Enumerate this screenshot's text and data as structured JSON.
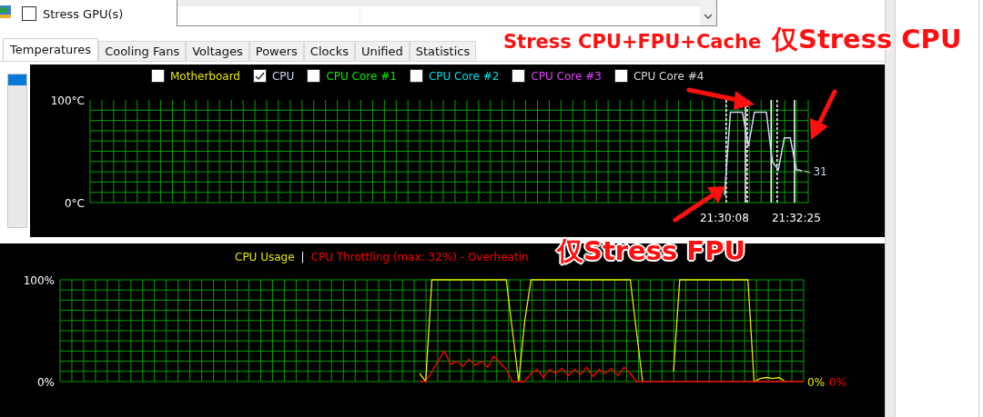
{
  "toolbar": {
    "stress_gpu": {
      "label": "Stress GPU(s)",
      "checked": false
    }
  },
  "tabs": [
    {
      "label": "Temperatures",
      "selected": true
    },
    {
      "label": "Cooling Fans",
      "selected": false
    },
    {
      "label": "Voltages",
      "selected": false
    },
    {
      "label": "Powers",
      "selected": false
    },
    {
      "label": "Clocks",
      "selected": false
    },
    {
      "label": "Unified",
      "selected": false
    },
    {
      "label": "Statistics",
      "selected": false
    }
  ],
  "temperature_chart": {
    "legend": [
      {
        "label": "Motherboard",
        "checked": false,
        "color": "#e8e800"
      },
      {
        "label": "CPU",
        "checked": true,
        "color": "#c8d8f0"
      },
      {
        "label": "CPU Core #1",
        "checked": false,
        "color": "#00ee00"
      },
      {
        "label": "CPU Core #2",
        "checked": false,
        "color": "#00e0e8"
      },
      {
        "label": "CPU Core #3",
        "checked": false,
        "color": "#e040ff"
      },
      {
        "label": "CPU Core #4",
        "checked": false,
        "color": "#d8d8d8"
      }
    ],
    "reading": "31",
    "chart_data": {
      "type": "line",
      "categories": [
        null,
        null,
        null,
        null,
        null,
        null,
        null,
        null,
        null,
        null,
        null,
        null,
        null,
        null,
        null,
        null,
        null,
        null,
        null,
        null,
        null,
        null,
        null,
        null,
        null,
        null,
        null,
        null,
        null,
        null,
        null,
        null,
        null,
        null,
        null,
        null,
        null,
        null,
        null,
        null,
        null,
        null,
        null,
        null,
        null,
        null,
        null,
        null,
        null,
        null,
        null,
        null,
        null,
        null,
        null,
        null,
        null,
        null,
        null,
        null,
        null,
        null,
        null,
        null,
        null,
        null,
        null,
        null,
        null,
        null,
        null,
        null,
        null,
        null,
        null,
        null,
        null,
        null,
        null,
        null,
        null,
        null,
        null,
        null,
        null,
        null,
        null,
        null,
        null,
        null,
        null,
        null,
        null,
        null,
        null,
        null,
        null,
        null,
        null,
        null,
        null,
        null,
        null,
        null,
        null,
        null,
        "21:30:08",
        null,
        null,
        null,
        null,
        null,
        null,
        null,
        null,
        null,
        null,
        null,
        "21:32:25",
        null,
        null
      ],
      "series": [
        {
          "color": "#c8d8f0",
          "values": [
            null,
            null,
            null,
            null,
            null,
            null,
            null,
            null,
            null,
            null,
            null,
            null,
            null,
            null,
            null,
            null,
            null,
            null,
            null,
            null,
            null,
            null,
            null,
            null,
            null,
            null,
            null,
            null,
            null,
            null,
            null,
            null,
            null,
            null,
            null,
            null,
            null,
            null,
            null,
            null,
            null,
            null,
            null,
            null,
            null,
            null,
            null,
            null,
            null,
            null,
            null,
            null,
            null,
            null,
            null,
            null,
            null,
            null,
            null,
            null,
            null,
            null,
            null,
            null,
            null,
            null,
            null,
            null,
            null,
            null,
            null,
            null,
            null,
            null,
            null,
            null,
            null,
            null,
            null,
            null,
            null,
            null,
            null,
            null,
            null,
            null,
            null,
            null,
            null,
            null,
            null,
            null,
            null,
            null,
            null,
            null,
            null,
            null,
            null,
            null,
            null,
            null,
            null,
            null,
            null,
            null,
            7,
            88,
            88,
            88,
            55,
            88,
            88,
            88,
            40,
            32,
            63,
            63,
            32,
            31,
            null
          ]
        }
      ],
      "ylim": [
        0,
        100
      ],
      "grid": true,
      "yticks": [
        {
          "value": 100,
          "label": "100°C"
        },
        {
          "value": 0,
          "label": "0°C"
        }
      ]
    }
  },
  "usage_chart": {
    "separator": "|",
    "readings": [
      {
        "text": "0%",
        "color": "#e8e800"
      },
      {
        "text": "0%",
        "color": "#ff0000"
      }
    ],
    "chart_data": {
      "type": "line",
      "categories": [
        null,
        null,
        null,
        null,
        null,
        null,
        null,
        null,
        null,
        null,
        null,
        null,
        null,
        null,
        null,
        null,
        null,
        null,
        null,
        null,
        null,
        null,
        null,
        null,
        null,
        null,
        null,
        null,
        null,
        null,
        null,
        null,
        null,
        null,
        null,
        null,
        null,
        null,
        null,
        null,
        null,
        null,
        null,
        null,
        null,
        null,
        null,
        null,
        null,
        null,
        null,
        null,
        null,
        null,
        null,
        null,
        null,
        null,
        null,
        null,
        null,
        null,
        null,
        null,
        null,
        null,
        null,
        null,
        null,
        null,
        null,
        null,
        null,
        null,
        null,
        null,
        null,
        null,
        null,
        null,
        null,
        null,
        null,
        null,
        null,
        null,
        null,
        null,
        null,
        null,
        null,
        null,
        null,
        null,
        null,
        null,
        null,
        null,
        null,
        null,
        null,
        null,
        null,
        null,
        null,
        null,
        null,
        null,
        null,
        null,
        null,
        null,
        null,
        null,
        null,
        null,
        null,
        null,
        null,
        null,
        null
      ],
      "series": [
        {
          "name": "CPU Usage",
          "color": "#e8e800",
          "values": [
            null,
            null,
            null,
            null,
            null,
            null,
            null,
            null,
            null,
            null,
            null,
            null,
            null,
            null,
            null,
            null,
            null,
            null,
            null,
            null,
            null,
            null,
            null,
            null,
            null,
            null,
            null,
            null,
            null,
            null,
            null,
            null,
            null,
            null,
            null,
            null,
            null,
            null,
            null,
            null,
            null,
            null,
            null,
            null,
            null,
            null,
            null,
            null,
            null,
            null,
            null,
            null,
            null,
            null,
            null,
            null,
            null,
            null,
            8,
            0,
            100,
            100,
            100,
            100,
            100,
            100,
            100,
            100,
            100,
            100,
            100,
            100,
            100,
            50,
            0,
            60,
            100,
            100,
            100,
            100,
            100,
            100,
            100,
            100,
            100,
            100,
            100,
            100,
            100,
            100,
            100,
            100,
            100,
            50,
            0,
            null,
            null,
            null,
            null,
            10,
            100,
            100,
            100,
            100,
            100,
            100,
            100,
            100,
            100,
            100,
            100,
            100,
            0,
            3,
            4,
            3,
            4,
            0,
            null,
            null,
            null
          ]
        },
        {
          "name": "CPU Throttling (max: 32%) - Overheatin",
          "color": "#ff0000",
          "values": [
            null,
            null,
            null,
            null,
            null,
            null,
            null,
            null,
            null,
            null,
            null,
            null,
            null,
            null,
            null,
            null,
            null,
            null,
            null,
            null,
            null,
            null,
            null,
            null,
            null,
            null,
            null,
            null,
            null,
            null,
            null,
            null,
            null,
            null,
            null,
            null,
            null,
            null,
            null,
            null,
            null,
            null,
            null,
            null,
            null,
            null,
            null,
            null,
            null,
            null,
            null,
            null,
            null,
            null,
            null,
            null,
            null,
            null,
            0,
            0,
            10,
            20,
            30,
            17,
            20,
            15,
            22,
            16,
            20,
            14,
            25,
            18,
            12,
            0,
            0,
            0,
            8,
            12,
            4,
            12,
            8,
            13,
            6,
            12,
            7,
            14,
            5,
            12,
            8,
            13,
            6,
            14,
            8,
            0,
            0,
            0,
            0,
            0,
            0,
            0,
            0,
            0,
            0,
            0,
            0,
            0,
            0,
            0,
            0,
            0,
            0,
            0,
            0,
            0,
            0,
            0,
            0,
            0,
            0,
            0,
            0
          ]
        }
      ],
      "ylim": [
        0,
        100
      ],
      "grid": true,
      "yticks": [
        {
          "value": 100,
          "label": "100%"
        },
        {
          "value": 0,
          "label": "0%"
        }
      ]
    }
  },
  "annotations": [
    {
      "text": "Stress CPU+FPU+Cache"
    },
    {
      "text": "仅Stress CPU"
    },
    {
      "text": "仅Stress FPU"
    }
  ]
}
